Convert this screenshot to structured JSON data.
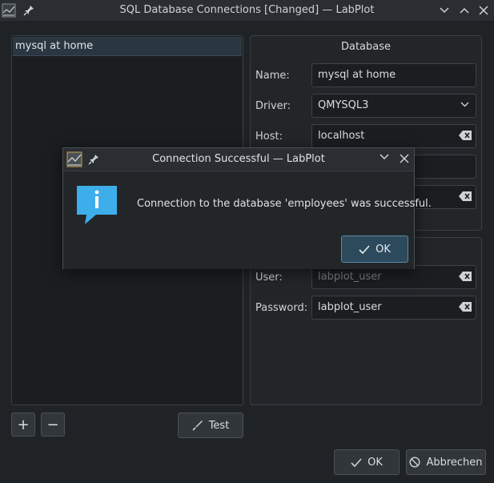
{
  "window": {
    "title": "SQL Database Connections [Changed] — LabPlot"
  },
  "connections": {
    "items": [
      {
        "label": "mysql at home"
      }
    ]
  },
  "database_group": {
    "title": "Database",
    "name_label": "Name:",
    "name_value": "mysql at home",
    "driver_label": "Driver:",
    "driver_value": "QMYSQL3",
    "host_label": "Host:",
    "host_value": "localhost"
  },
  "auth_group": {
    "user_label": "User:",
    "user_value": "labplot_user",
    "password_label": "Password:",
    "password_value": "labplot_user"
  },
  "toolbar": {
    "add_label": "+",
    "remove_label": "−",
    "test_label": "Test"
  },
  "footer": {
    "ok_label": "OK",
    "cancel_label": "Abbrechen"
  },
  "dialog": {
    "title": "Connection Successful — LabPlot",
    "message": "Connection to the database 'employees' was successful.",
    "ok_label": "OK"
  },
  "colors": {
    "accent": "#3daee9",
    "selection": "#2b3740"
  }
}
